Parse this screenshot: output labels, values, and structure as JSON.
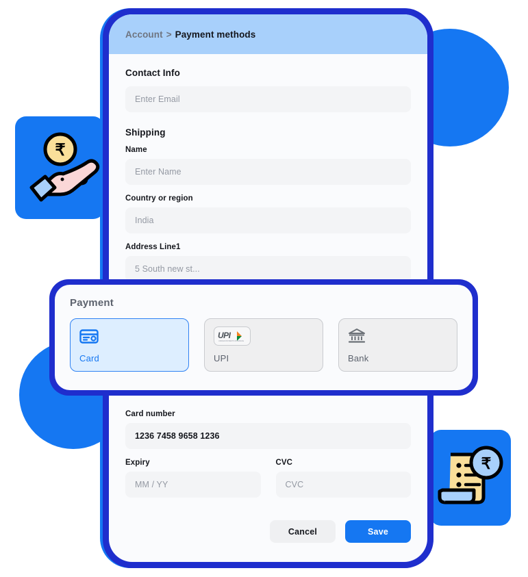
{
  "breadcrumb": {
    "root": "Account",
    "separator": ">",
    "current": "Payment methods"
  },
  "sections": {
    "contact_title": "Contact Info",
    "shipping_title": "Shipping"
  },
  "fields": {
    "email": {
      "label": "",
      "placeholder": "Enter Email",
      "value": ""
    },
    "name": {
      "label": "Name",
      "placeholder": "Enter Name",
      "value": ""
    },
    "country": {
      "label": "Country or region",
      "placeholder": "India",
      "value": ""
    },
    "address1": {
      "label": "Address Line1",
      "placeholder": "5 South new st...",
      "value": ""
    },
    "card_number": {
      "label": "Card number",
      "placeholder": "",
      "value": "1236 7458 9658 1236"
    },
    "expiry": {
      "label": "Expiry",
      "placeholder": "MM / YY",
      "value": ""
    },
    "cvc": {
      "label": "CVC",
      "placeholder": "CVC",
      "value": ""
    }
  },
  "payment": {
    "title": "Payment",
    "selected": "Card",
    "methods": [
      {
        "label": "Card",
        "icon": "credit-card-icon",
        "selected": true
      },
      {
        "label": "UPI",
        "icon": "upi-logo-icon",
        "selected": false
      },
      {
        "label": "Bank",
        "icon": "bank-building-icon",
        "selected": false
      }
    ],
    "upi_logo_text": "UPI",
    "upi_logo_subtext": "UNIFIED PAYMENTS INTERFACE"
  },
  "actions": {
    "cancel_label": "Cancel",
    "save_label": "Save"
  },
  "colors": {
    "accent_blue": "#1577f2",
    "frame_blue": "#1f2ecd",
    "header_blue": "#a8d0fb",
    "selected_tile_bg": "#ddeeff",
    "input_bg": "#f3f4f6",
    "coin_yellow": "#fadf9a",
    "hand_pink": "#fbd7d7",
    "light_blue": "#a8d0fb"
  }
}
